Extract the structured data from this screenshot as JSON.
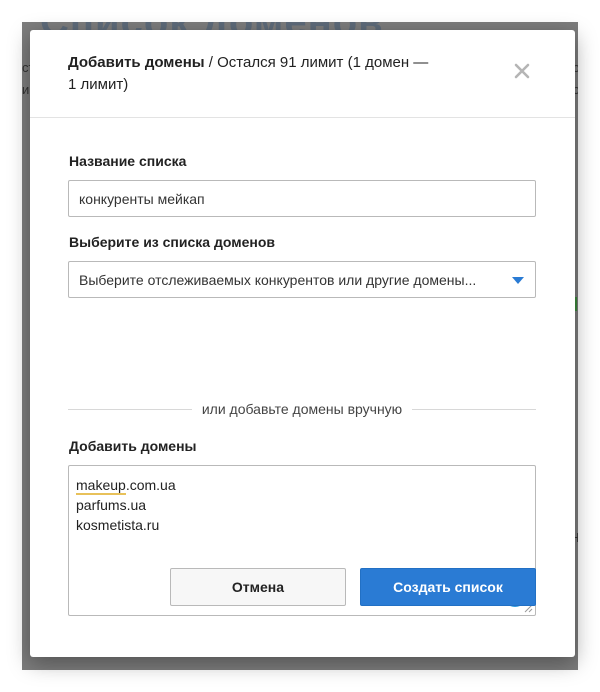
{
  "background": {
    "heading": "Список доменов",
    "left_snippets": [
      "ст",
      "ир"
    ],
    "right_snippets": [
      "ю",
      "ю"
    ],
    "right_snippet_bottom": "H"
  },
  "modal": {
    "title_bold": "Добавить домены",
    "title_rest": " / Остался 91 лимит (1 домен — 1 лимит)",
    "close_icon": "close-icon",
    "list_name": {
      "label": "Название списка",
      "value": "конкуренты мейкап"
    },
    "domain_select": {
      "label": "Выберите из списка доменов",
      "placeholder": "Выберите отслеживаемых конкурентов или другие домены..."
    },
    "divider_text": "или добавьте домены вручную",
    "add_domains": {
      "label": "Добавить домены",
      "lines": [
        "makeup.com.ua",
        "parfums.ua",
        "kosmetista.ru"
      ],
      "underlined_part": "makeup",
      "first_line_rest": ".com.ua"
    },
    "buttons": {
      "cancel": "Отмена",
      "create": "Создать список"
    }
  },
  "colors": {
    "accent": "#2a7bd4",
    "grammar_icon": "#2a9ae0",
    "underline": "#e8c15a"
  }
}
